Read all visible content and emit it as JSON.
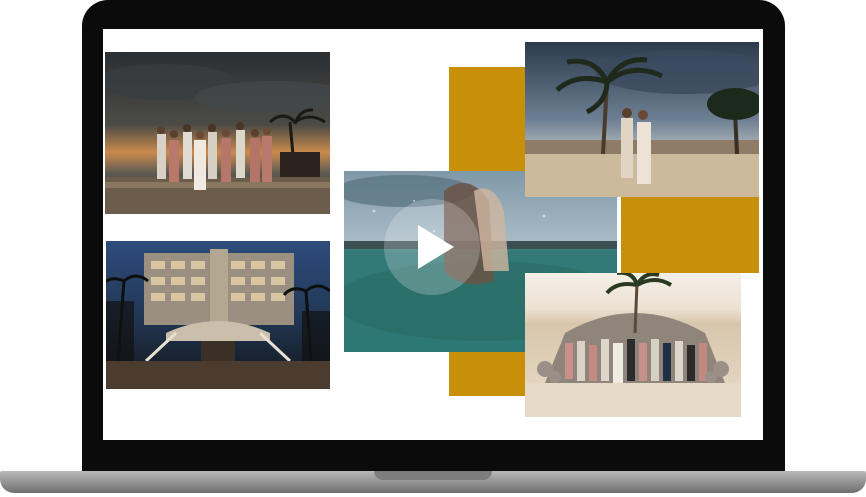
{
  "colors": {
    "accent": "#c8900a",
    "bezel": "#0b0b0b",
    "screen": "#ffffff",
    "base": "#9a9a9a"
  },
  "gallery": {
    "photos": [
      {
        "name": "wedding-party-sunset-photo"
      },
      {
        "name": "resort-building-night-photo"
      },
      {
        "name": "underwater-couple-video-thumbnail"
      },
      {
        "name": "couple-palm-tree-photo"
      },
      {
        "name": "beach-group-photo"
      }
    ]
  },
  "video": {
    "play_icon": "play-icon"
  }
}
